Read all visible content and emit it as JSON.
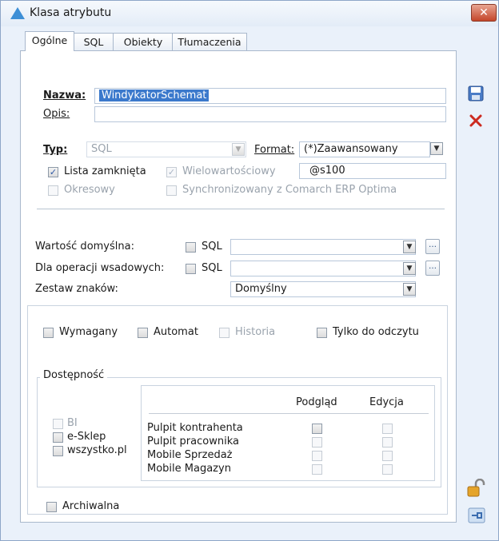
{
  "window": {
    "title": "Klasa atrybutu",
    "close_label": "✕"
  },
  "tabs": [
    {
      "label": "Ogólne"
    },
    {
      "label": "SQL"
    },
    {
      "label": "Obiekty"
    },
    {
      "label": "Tłumaczenia"
    }
  ],
  "general": {
    "name_label": "Nazwa:",
    "name_value": "WindykatorSchemat",
    "desc_label": "Opis:",
    "desc_value": "",
    "type_label": "Typ:",
    "type_value": "SQL",
    "format_label": "Format:",
    "format_value": "(*)Zaawansowany",
    "closed_list_label": "Lista zamknięta",
    "multivalue_label": "Wielowartościowy",
    "format_string": "@s100",
    "periodic_label": "Okresowy",
    "sync_label": "Synchronizowany z Comarch ERP Optima",
    "default_value_label": "Wartość domyślna:",
    "default_sql_label": "SQL",
    "batch_label": "Dla operacji wsadowych:",
    "batch_sql_label": "SQL",
    "charset_label": "Zestaw znaków:",
    "charset_value": "Domyślny"
  },
  "flags": {
    "required_label": "Wymagany",
    "auto_label": "Automat",
    "history_label": "Historia",
    "readonly_label": "Tylko do odczytu"
  },
  "availability": {
    "title": "Dostępność",
    "channels": [
      "BI",
      "e-Sklep",
      "wszystko.pl"
    ],
    "col_preview": "Podgląd",
    "col_edit": "Edycja",
    "rows": [
      "Pulpit kontrahenta",
      "Pulpit pracownika",
      "Mobile Sprzedaż",
      "Mobile Magazyn"
    ]
  },
  "archive_label": "Archiwalna",
  "glyphs": {
    "check": "✓",
    "dropdown": "▼",
    "ellipsis": "…"
  },
  "icons": [
    "triangle-app-icon",
    "save-icon",
    "delete-icon",
    "unlock-icon",
    "pin-icon"
  ]
}
